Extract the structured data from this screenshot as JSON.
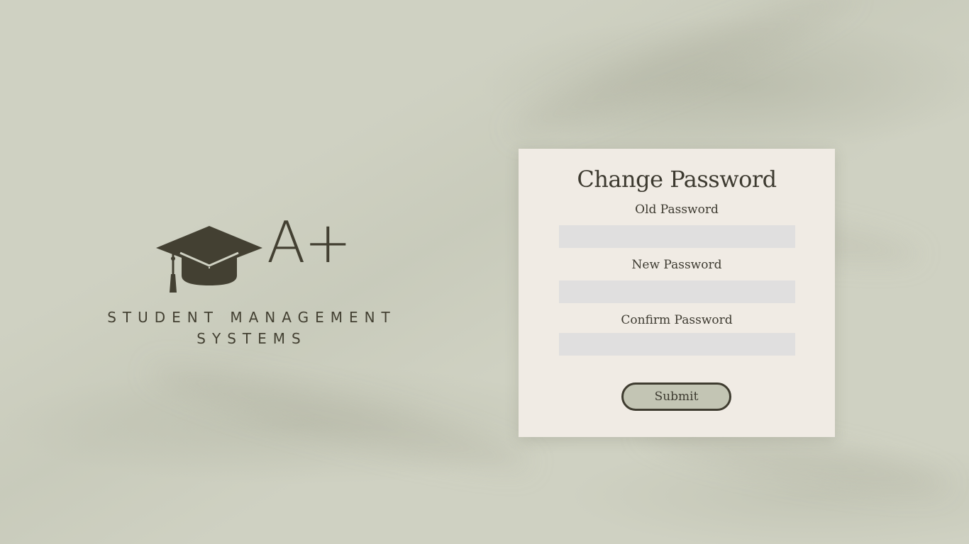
{
  "brand": {
    "grade_mark": "A+",
    "name_line1": "STUDENT MANAGEMENT",
    "name_line2": "SYSTEMS",
    "icon": "graduation-cap-icon",
    "color": "#434032"
  },
  "form": {
    "title": "Change Password",
    "fields": [
      {
        "label": "Old Password",
        "value": ""
      },
      {
        "label": "New Password",
        "value": ""
      },
      {
        "label": "Confirm Password",
        "value": ""
      }
    ],
    "submit_label": "Submit"
  },
  "colors": {
    "background": "#cfd1c2",
    "card": "#f0ebe4",
    "input": "#e0dfdf",
    "button_fill": "#c3c5b4",
    "text": "#3d3a30"
  }
}
